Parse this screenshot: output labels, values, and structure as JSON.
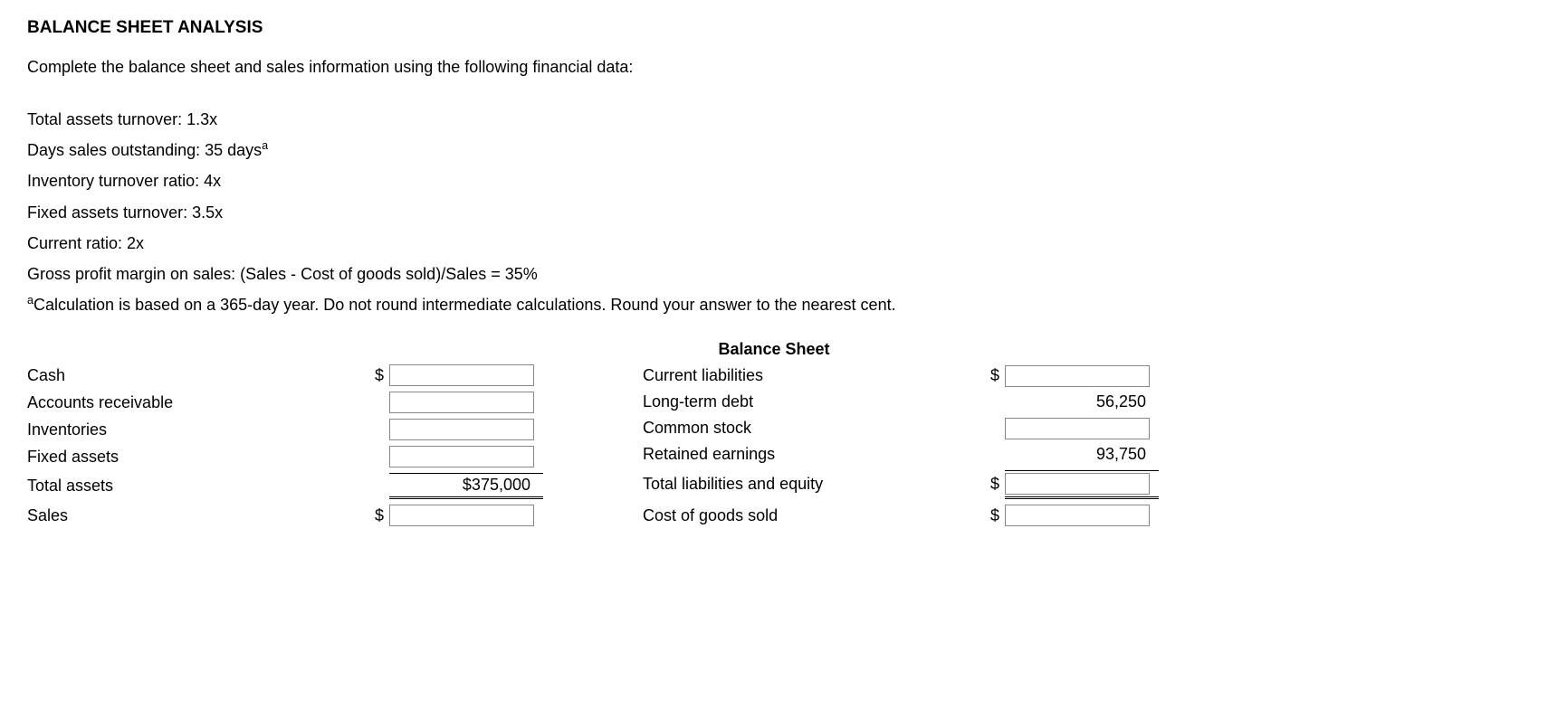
{
  "title": "BALANCE SHEET ANALYSIS",
  "intro": "Complete the balance sheet and sales information using the following financial data:",
  "given": {
    "l1": "Total assets turnover: 1.3x",
    "l2_pre": "Days sales outstanding: 35 days",
    "l2_sup": "a",
    "l3": "Inventory turnover ratio: 4x",
    "l4": "Fixed assets turnover: 3.5x",
    "l5": "Current ratio: 2x",
    "l6": "Gross profit margin on sales: (Sales - Cost of goods sold)/Sales = 35%"
  },
  "footnote": {
    "sup": "a",
    "text": "Calculation is based on a 365-day year. Do not round intermediate calculations. Round your answer to the nearest cent."
  },
  "bs_heading": "Balance Sheet",
  "left": {
    "cash": "Cash",
    "ar": "Accounts receivable",
    "inv": "Inventories",
    "fa": "Fixed assets",
    "ta": "Total assets",
    "ta_val": "$375,000",
    "sales": "Sales"
  },
  "right": {
    "cl": "Current liabilities",
    "ltd": "Long-term debt",
    "ltd_val": "56,250",
    "cs": "Common stock",
    "re": "Retained earnings",
    "re_val": "93,750",
    "tle": "Total liabilities and equity",
    "cogs": "Cost of goods sold"
  },
  "dollar": "$"
}
